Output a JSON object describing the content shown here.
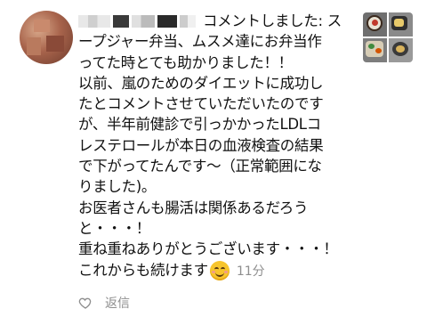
{
  "comment": {
    "author_suffix": "コメントしました: ス",
    "lines": [
      "ープジャー弁当、ムスメ達にお弁当作",
      "ってた時とても助かりました！！",
      "以前、嵐のためのダイエットに成功し",
      "たとコメントさせていただいたのです",
      "が、半年前健診で引っかかったLDLコ",
      "レステロールが本日の血液検査の結果",
      "で下がってたんです〜（正常範囲にな",
      "りました)。",
      "お医者さんも腸活は関係あるだろう",
      "と・・・！",
      "重ね重ねありがとうございます・・・！",
      "これからも続けます"
    ],
    "emoji": "smiling-face-emoji",
    "timestamp": "11分"
  },
  "actions": {
    "reply_label": "返信",
    "heart_icon": "heart-outline-icon"
  },
  "colors": {
    "text": "#111111",
    "meta": "#8e8e8e",
    "emoji_face": "#f7c52d"
  }
}
